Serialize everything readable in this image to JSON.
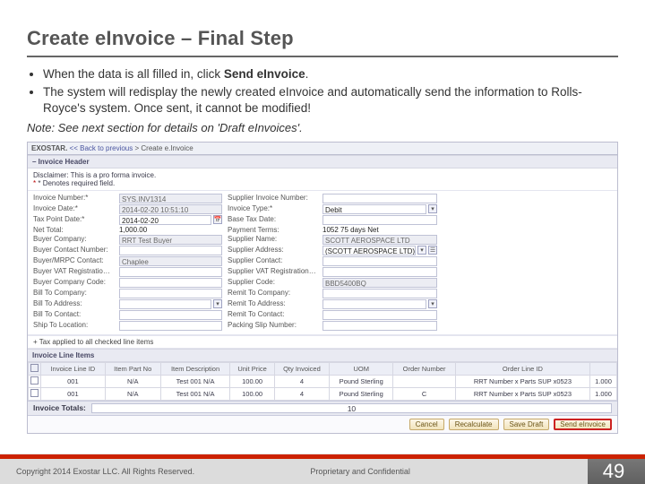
{
  "title": "Create eInvoice – Final Step",
  "bullets": [
    {
      "parts": [
        "When the data is all filled in, click ",
        "Send eInvoice",
        "."
      ]
    },
    {
      "parts": [
        "The system will redisplay the newly created eInvoice and automatically send the information to Rolls-Royce's system.  Once sent, it cannot be modified!"
      ]
    }
  ],
  "note": "Note:  See next section for details on 'Draft eInvoices'.",
  "breadcrumb": {
    "brand": "EXOSTAR.",
    "back": "<< Back to previous",
    "current": "Create e.Invoice"
  },
  "section_header": "– Invoice Header",
  "disclaimer_line1": "Disclaimer: This is a pro forma invoice.",
  "disclaimer_line2": "* Denotes required field.",
  "header_rows": [
    {
      "l1": "Invoice Number:*",
      "v1": "SYS.INV1314",
      "l2": "Supplier Invoice Number:",
      "v2": ""
    },
    {
      "l1": "Invoice Date:*",
      "v1": "2014-02-20 10:51:10",
      "l2": "Invoice Type:*",
      "v2": "Debit"
    },
    {
      "l1": "Tax Point Date:*",
      "v1": "2014-02-20",
      "l2": "Base Tax Date:",
      "v2": ""
    },
    {
      "l1": "Net Total:",
      "v1": "1,000.00",
      "l2": "Payment Terms:",
      "v2": "1052 75 days Net"
    },
    {
      "l1": "Buyer Company:",
      "v1": "RRT Test Buyer",
      "l2": "Supplier Name:",
      "v2": "SCOTT AEROSPACE LTD"
    },
    {
      "l1": "Buyer Contact Number:",
      "v1": "",
      "l2": "Supplier Address:",
      "v2": "(SCOTT AEROSPACE LTD)"
    },
    {
      "l1": "Buyer/MRPC Contact:",
      "v1": "Chaplee",
      "l2": "Supplier Contact:",
      "v2": ""
    },
    {
      "l1": "Buyer VAT Registration Number:",
      "v1": "",
      "l2": "Supplier VAT Registration Number:",
      "v2": ""
    },
    {
      "l1": "Buyer Company Code:",
      "v1": "",
      "l2": "Supplier Code:",
      "v2": "BBD5400BQ"
    },
    {
      "l1": "Bill To Company:",
      "v1": "",
      "l2": "Remit To Company:",
      "v2": ""
    },
    {
      "l1": "Bill To Address:",
      "v1": "",
      "l2": "Remit To Address:",
      "v2": ""
    },
    {
      "l1": "Bill To Contact:",
      "v1": "",
      "l2": "Remit To Contact:",
      "v2": ""
    },
    {
      "l1": "Ship To Location:",
      "v1": "",
      "l2": "Packing Slip Number:",
      "v2": ""
    }
  ],
  "tax_row": "+ Tax applied to all checked line items",
  "section_lines": "Invoice Line Items",
  "line_cols": [
    "",
    "Invoice Line ID",
    "Item Part No",
    "Item Description",
    "Unit Price",
    "Qty Invoiced",
    "UOM",
    "Order Number",
    "Order Line ID"
  ],
  "line_rows": [
    [
      "",
      "001",
      "N/A",
      "Test 001 N/A",
      "100.00",
      "4",
      "Pound Sterling",
      "",
      "RRT Number x Parts SUP x0523"
    ],
    [
      "",
      "001",
      "N/A",
      "Test 001 N/A",
      "100.00",
      "4",
      "Pound Sterling",
      "C",
      "RRT Number x Parts SUP x0523"
    ]
  ],
  "line_col10": "1.000",
  "totals_label": "Invoice Totals:",
  "totals_qty": "10",
  "actions": {
    "cancel": "Cancel",
    "recalc": "Recalculate",
    "save": "Save Draft",
    "send": "Send eInvoice"
  },
  "footer": {
    "left": "Copyright 2014 Exostar LLC. All Rights Reserved.",
    "center": "Proprietary and Confidential",
    "page": "49"
  }
}
